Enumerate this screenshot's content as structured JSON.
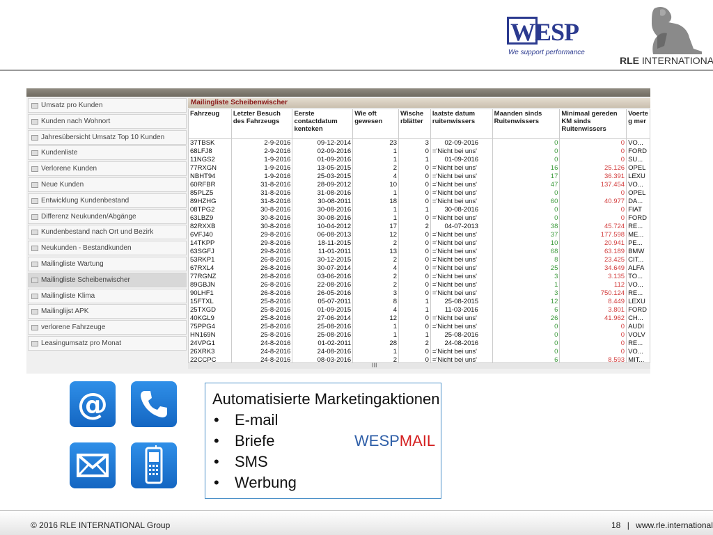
{
  "header": {
    "wesp_logo_text": "WESP",
    "wesp_tagline": "We support performance",
    "rle_brand_bold": "RLE",
    "rle_brand_rest": " INTERNATIONAL"
  },
  "sidebar": {
    "items": [
      {
        "label": "Umsatz pro Kunden",
        "active": false
      },
      {
        "label": "Kunden  nach Wohnort",
        "active": false
      },
      {
        "label": "Jahresübersicht Umsatz Top 10 Kunden",
        "active": false
      },
      {
        "label": "Kundenliste",
        "active": false
      },
      {
        "label": "Verlorene Kunden",
        "active": false
      },
      {
        "label": "Neue Kunden",
        "active": false
      },
      {
        "label": "Entwicklung Kundenbestand",
        "active": false
      },
      {
        "label": "Differenz Neukunden/Abgänge",
        "active": false
      },
      {
        "label": "Kundenbestand nach Ort und Bezirk",
        "active": false
      },
      {
        "label": "Neukunden   -   Bestandkunden",
        "active": false
      },
      {
        "label": "Mailingliste Wartung",
        "active": false
      },
      {
        "label": "Mailingliste Scheibenwischer",
        "active": true
      },
      {
        "label": "Mailingliste Klima",
        "active": false
      },
      {
        "label": "Mailinglijst APK",
        "active": false
      },
      {
        "label": "verlorene Fahrzeuge",
        "active": false
      },
      {
        "label": "Leasingumsatz pro Monat",
        "active": false
      }
    ]
  },
  "report": {
    "title": "Mailingliste Scheibenwischer",
    "columns": [
      "Fahrzeug",
      "Letzter Besuch des Fahrzeugs",
      "Eerste contactdatum kenteken",
      "Wie oft gewesen",
      "Wische rblätter",
      "laatste datum ruitenwissers",
      "Maanden sinds Ruitenwissers",
      "Minimaal gereden KM sinds Ruitenwissers",
      "Voerte g mer"
    ],
    "rows": [
      [
        "37TBSK",
        "2-9-2016",
        "09-12-2014",
        "23",
        "3",
        "02-09-2016",
        "0",
        "0",
        "VO..."
      ],
      [
        "68LFJ8",
        "2-9-2016",
        "02-09-2016",
        "1",
        "0",
        "='Nicht bei uns'",
        "0",
        "0",
        "FORD"
      ],
      [
        "11NGS2",
        "1-9-2016",
        "01-09-2016",
        "1",
        "1",
        "01-09-2016",
        "0",
        "0",
        "SU..."
      ],
      [
        "77RXGN",
        "1-9-2016",
        "13-05-2015",
        "2",
        "0",
        "='Nicht bei uns'",
        "16",
        "25.126",
        "OPEL"
      ],
      [
        "NBHT94",
        "1-9-2016",
        "25-03-2015",
        "4",
        "0",
        "='Nicht bei uns'",
        "17",
        "36.391",
        "LEXU"
      ],
      [
        "60RFBR",
        "31-8-2016",
        "28-09-2012",
        "10",
        "0",
        "='Nicht bei uns'",
        "47",
        "137.454",
        "VO..."
      ],
      [
        "85PLZ5",
        "31-8-2016",
        "31-08-2016",
        "1",
        "0",
        "='Nicht bei uns'",
        "0",
        "0",
        "OPEL"
      ],
      [
        "89HZHG",
        "31-8-2016",
        "30-08-2011",
        "18",
        "0",
        "='Nicht bei uns'",
        "60",
        "40.977",
        "DA..."
      ],
      [
        "08TPG2",
        "30-8-2016",
        "30-08-2016",
        "1",
        "1",
        "30-08-2016",
        "0",
        "0",
        "FIAT"
      ],
      [
        "63LBZ9",
        "30-8-2016",
        "30-08-2016",
        "1",
        "0",
        "='Nicht bei uns'",
        "0",
        "0",
        "FORD"
      ],
      [
        "82RXXB",
        "30-8-2016",
        "10-04-2012",
        "17",
        "2",
        "04-07-2013",
        "38",
        "45.724",
        "RE..."
      ],
      [
        "6VFJ40",
        "29-8-2016",
        "06-08-2013",
        "12",
        "0",
        "='Nicht bei uns'",
        "37",
        "177.598",
        "ME..."
      ],
      [
        "14TKPP",
        "29-8-2016",
        "18-11-2015",
        "2",
        "0",
        "='Nicht bei uns'",
        "10",
        "20.941",
        "PE..."
      ],
      [
        "63SGFJ",
        "29-8-2016",
        "11-01-2011",
        "13",
        "0",
        "='Nicht bei uns'",
        "68",
        "63.189",
        "BMW"
      ],
      [
        "53RKP1",
        "26-8-2016",
        "30-12-2015",
        "2",
        "0",
        "='Nicht bei uns'",
        "8",
        "23.425",
        "CIT..."
      ],
      [
        "67RXL4",
        "26-8-2016",
        "30-07-2014",
        "4",
        "0",
        "='Nicht bei uns'",
        "25",
        "34.649",
        "ALFA"
      ],
      [
        "77RGNZ",
        "26-8-2016",
        "03-06-2016",
        "2",
        "0",
        "='Nicht bei uns'",
        "3",
        "3.135",
        "TO..."
      ],
      [
        "89GBJN",
        "26-8-2016",
        "22-08-2016",
        "2",
        "0",
        "='Nicht bei uns'",
        "1",
        "112",
        "VO..."
      ],
      [
        "90LHF1",
        "26-8-2016",
        "26-05-2016",
        "3",
        "0",
        "='Nicht bei uns'",
        "3",
        "750.124",
        "RE..."
      ],
      [
        "15FTXL",
        "25-8-2016",
        "05-07-2011",
        "8",
        "1",
        "25-08-2015",
        "12",
        "8.449",
        "LEXU"
      ],
      [
        "25TXGD",
        "25-8-2016",
        "01-09-2015",
        "4",
        "1",
        "11-03-2016",
        "6",
        "3.801",
        "FORD"
      ],
      [
        "40KGL9",
        "25-8-2016",
        "27-06-2014",
        "12",
        "0",
        "='Nicht bei uns'",
        "26",
        "41.962",
        "CH..."
      ],
      [
        "75PPG4",
        "25-8-2016",
        "25-08-2016",
        "1",
        "0",
        "='Nicht bei uns'",
        "0",
        "0",
        "AUDI"
      ],
      [
        "HN169N",
        "25-8-2016",
        "25-08-2016",
        "1",
        "1",
        "25-08-2016",
        "0",
        "0",
        "VOLV"
      ],
      [
        "24VPG1",
        "24-8-2016",
        "01-02-2011",
        "28",
        "2",
        "24-08-2016",
        "0",
        "0",
        "RE..."
      ],
      [
        "26XRK3",
        "24-8-2016",
        "24-08-2016",
        "1",
        "0",
        "='Nicht bei uns'",
        "0",
        "0",
        "VO..."
      ],
      [
        "22CCPC",
        "24-8-2016",
        "08-03-2016",
        "2",
        "0",
        "='Nicht bei uns'",
        "6",
        "8.593",
        "MIT..."
      ]
    ],
    "colors": {
      "months": "#3b9a3b",
      "km": "#d23b3b"
    }
  },
  "icons": [
    "at-sign-icon",
    "phone-icon",
    "envelope-icon",
    "mobile-phone-icon"
  ],
  "textbox": {
    "title": "Automatisierte Marketingaktionen",
    "bullet": "•",
    "items": [
      "E-mail",
      "Briefe",
      "SMS",
      "Werbung"
    ],
    "brand_part1": "WESP",
    "brand_part2": "MAIL"
  },
  "footer": {
    "copyright": "© 2016 RLE INTERNATIONAL Group",
    "page_number": "18",
    "separator": "|",
    "website": "www.rle.international"
  }
}
